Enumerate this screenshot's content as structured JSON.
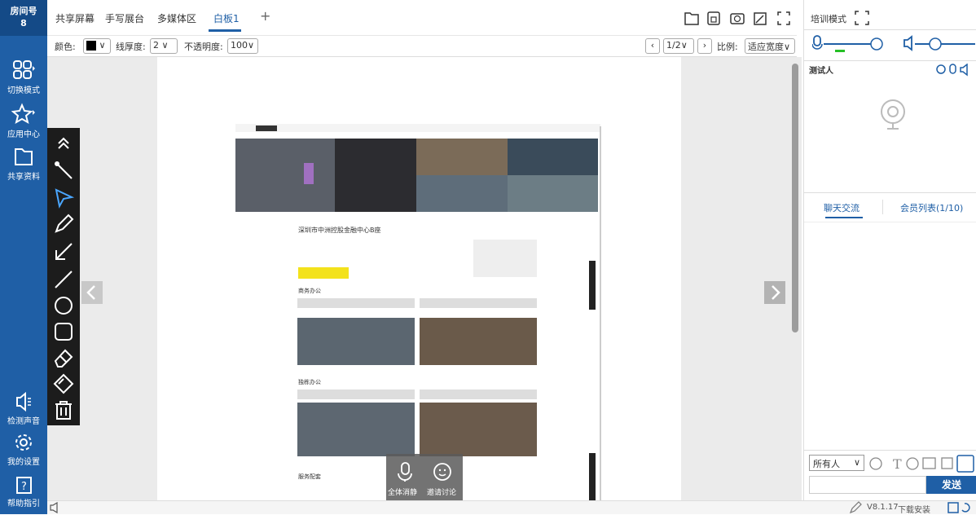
{
  "sidebar": {
    "room_title": "房间号",
    "room_number": "8",
    "items": [
      {
        "label": "切换模式"
      },
      {
        "label": "应用中心"
      },
      {
        "label": "共享资料"
      },
      {
        "label": "检测声音"
      },
      {
        "label": "我的设置"
      },
      {
        "label": "帮助指引"
      }
    ]
  },
  "tabs": [
    {
      "label": "共享屏幕"
    },
    {
      "label": "手写展台"
    },
    {
      "label": "多媒体区"
    },
    {
      "label": "白板1"
    }
  ],
  "toolbar": {
    "color_label": "颜色:",
    "line_label": "线厚度:",
    "line_value": "2",
    "opacity_label": "不透明度:",
    "opacity_value": "100",
    "page_value": "1/2",
    "scale_label": "比例:",
    "scale_value": "适应宽度"
  },
  "right": {
    "training_label": "培训模式",
    "video_name": "测试人",
    "chat_tab": "聊天交流",
    "members_tab": "会员列表(1/10)",
    "recipient": "所有人",
    "send_label": "发送"
  },
  "floating": {
    "mute_label": "全体消静",
    "invite_label": "邀请讨论"
  },
  "status": {
    "version": "V8.1.17",
    "download": "下载安装"
  },
  "doc": {
    "title": "深圳市中洲控股金融中心B座",
    "section1": "商务办公",
    "section2": "独栋办公",
    "section3": "服务配套"
  },
  "colors": {
    "brand": "#1f5fa6",
    "toolbar_bg": "#1c1c1c"
  }
}
